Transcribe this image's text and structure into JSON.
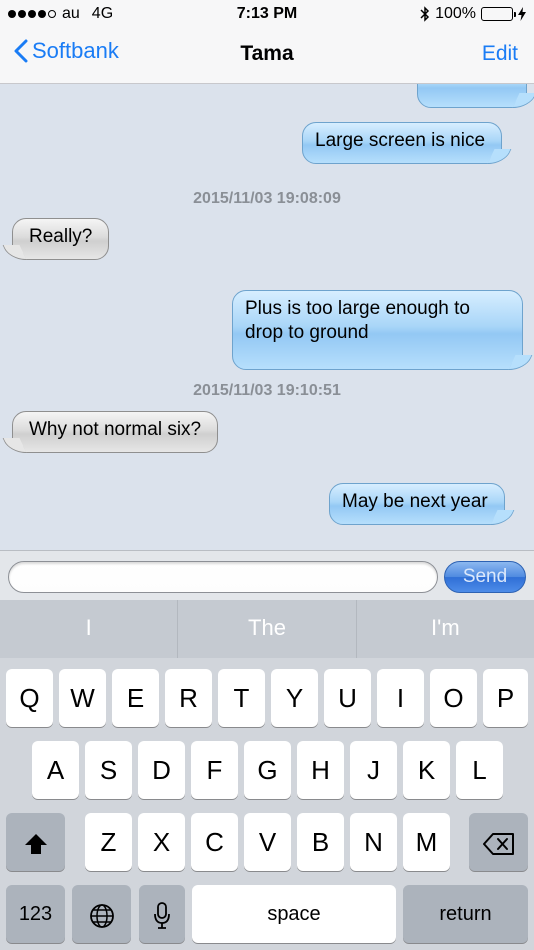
{
  "status_bar": {
    "carrier": "au",
    "network": "4G",
    "time": "7:13 PM",
    "battery": "100%"
  },
  "nav": {
    "back_label": "Softbank",
    "title": "Tama",
    "edit_label": "Edit"
  },
  "messages": [
    {
      "dir": "out",
      "text": "Large screen is nice"
    },
    {
      "dir": "ts",
      "text": "2015/11/03 19:08:09"
    },
    {
      "dir": "in",
      "text": "Really?"
    },
    {
      "dir": "out",
      "text": "Plus is too large enough to drop to ground"
    },
    {
      "dir": "ts",
      "text": "2015/11/03 19:10:51"
    },
    {
      "dir": "in",
      "text": "Why not normal six?"
    },
    {
      "dir": "out",
      "text": "May be next year"
    }
  ],
  "input": {
    "value": "",
    "placeholder": "",
    "send_label": "Send"
  },
  "predictions": [
    "I",
    "The",
    "I'm"
  ],
  "keyboard": {
    "row1": [
      "Q",
      "W",
      "E",
      "R",
      "T",
      "Y",
      "U",
      "I",
      "O",
      "P"
    ],
    "row2": [
      "A",
      "S",
      "D",
      "F",
      "G",
      "H",
      "J",
      "K",
      "L"
    ],
    "row3": [
      "Z",
      "X",
      "C",
      "V",
      "B",
      "N",
      "M"
    ],
    "numbers_label": "123",
    "space_label": "space",
    "return_label": "return"
  },
  "colors": {
    "accent": "#1a7cf5",
    "battery": "#4cd964"
  }
}
